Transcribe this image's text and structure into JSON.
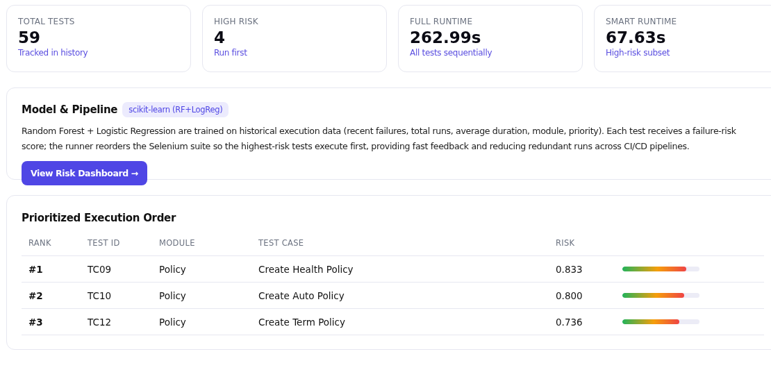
{
  "stats": [
    {
      "label": "TOTAL TESTS",
      "value": "59",
      "note": "Tracked in history"
    },
    {
      "label": "HIGH RISK",
      "value": "4",
      "note": "Run first"
    },
    {
      "label": "FULL RUNTIME",
      "value": "262.99s",
      "note": "All tests sequentially"
    },
    {
      "label": "SMART RUNTIME",
      "value": "67.63s",
      "note": "High-risk subset"
    }
  ],
  "pipeline": {
    "title": "Model & Pipeline",
    "badge": "scikit-learn (RF+LogReg)",
    "description": "Random Forest + Logistic Regression are trained on historical execution data (recent failures, total runs, average duration, module, priority). Each test receives a failure-risk score; the runner reorders the Selenium suite so the highest-risk tests execute first, providing fast feedback and reducing redundant runs across CI/CD pipelines.",
    "button": "View Risk Dashboard →"
  },
  "order": {
    "title": "Prioritized Execution Order",
    "columns": [
      "RANK",
      "TEST ID",
      "MODULE",
      "TEST CASE",
      "RISK"
    ],
    "rows": [
      {
        "rank": "#1",
        "test_id": "TC09",
        "module": "Policy",
        "test_case": "Create Health Policy",
        "risk": "0.833",
        "level": 0.833
      },
      {
        "rank": "#2",
        "test_id": "TC10",
        "module": "Policy",
        "test_case": "Create Auto Policy",
        "risk": "0.800",
        "level": 0.8
      },
      {
        "rank": "#3",
        "test_id": "TC12",
        "module": "Policy",
        "test_case": "Create Term Policy",
        "risk": "0.736",
        "level": 0.736
      }
    ]
  }
}
